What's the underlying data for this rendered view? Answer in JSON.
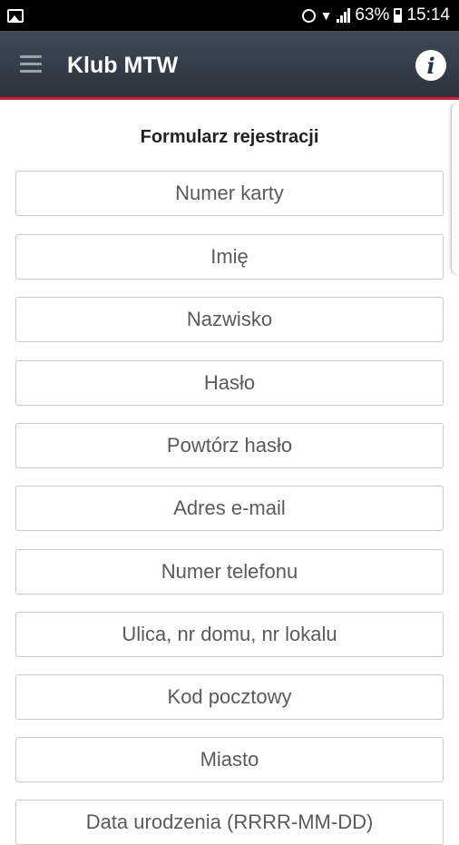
{
  "status_bar": {
    "battery": "63%",
    "time": "15:14"
  },
  "app_bar": {
    "title": "Klub MTW"
  },
  "form": {
    "title": "Formularz rejestracji",
    "fields": [
      "Numer karty",
      "Imię",
      "Nazwisko",
      "Hasło",
      "Powtórz hasło",
      "Adres e-mail",
      "Numer telefonu",
      "Ulica, nr domu, nr lokalu",
      "Kod pocztowy",
      "Miasto",
      "Data urodzenia (RRRR-MM-DD)"
    ]
  }
}
